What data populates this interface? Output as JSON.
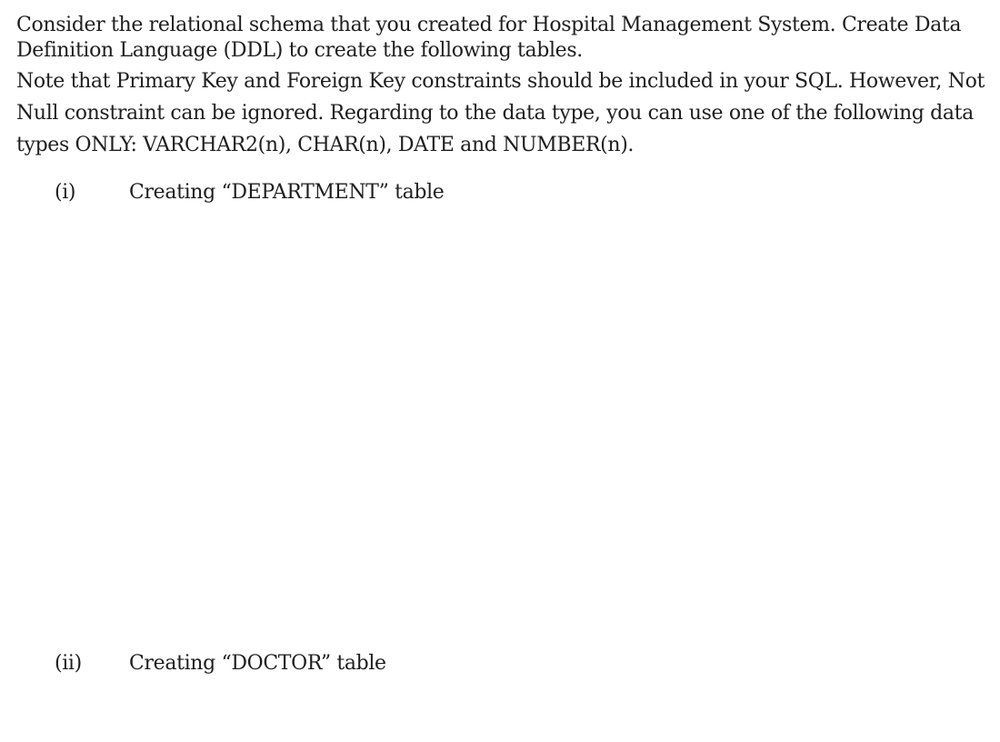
{
  "question": {
    "intro_lines": [
      "Consider the relational schema that you created for Hospital Management System. Create Data",
      "Definition Language (DDL) to create the following tables."
    ],
    "note_lines": [
      "Note that Primary Key and Foreign Key constraints should be included in your SQL. However, Not",
      "Null constraint can be ignored. Regarding to the data type, you can use one of the following data",
      "types ONLY: VARCHAR2(n), CHAR(n), DATE and NUMBER(n)."
    ],
    "items": [
      {
        "number": "(i)",
        "text": "Creating “DEPARTMENT” table"
      },
      {
        "number": "(ii)",
        "text": "Creating “DOCTOR” table"
      }
    ]
  }
}
